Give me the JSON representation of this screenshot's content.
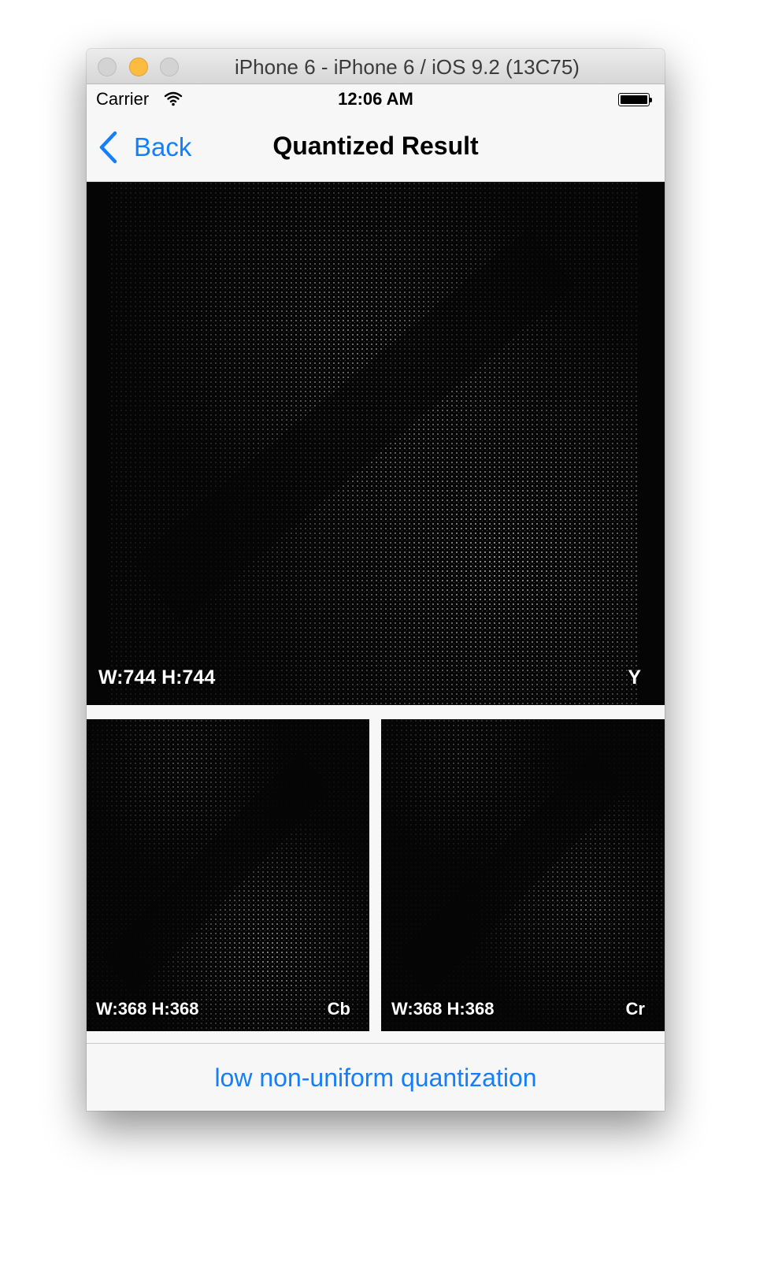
{
  "window": {
    "title": "iPhone 6 - iPhone 6 / iOS 9.2 (13C75)"
  },
  "status_bar": {
    "carrier": "Carrier",
    "time": "12:06 AM",
    "icons": [
      "wifi-icon",
      "battery-icon"
    ]
  },
  "nav": {
    "back_label": "Back",
    "title": "Quantized Result"
  },
  "images": {
    "y": {
      "size": "W:744  H:744",
      "channel": "Y"
    },
    "cb": {
      "size": "W:368  H:368",
      "channel": "Cb"
    },
    "cr": {
      "size": "W:368  H:368",
      "channel": "Cr"
    }
  },
  "footer": {
    "button_label": "low non-uniform quantization"
  },
  "colors": {
    "accent": "#157efb",
    "image_background": "#000000",
    "bar_background": "#f7f7f7"
  }
}
